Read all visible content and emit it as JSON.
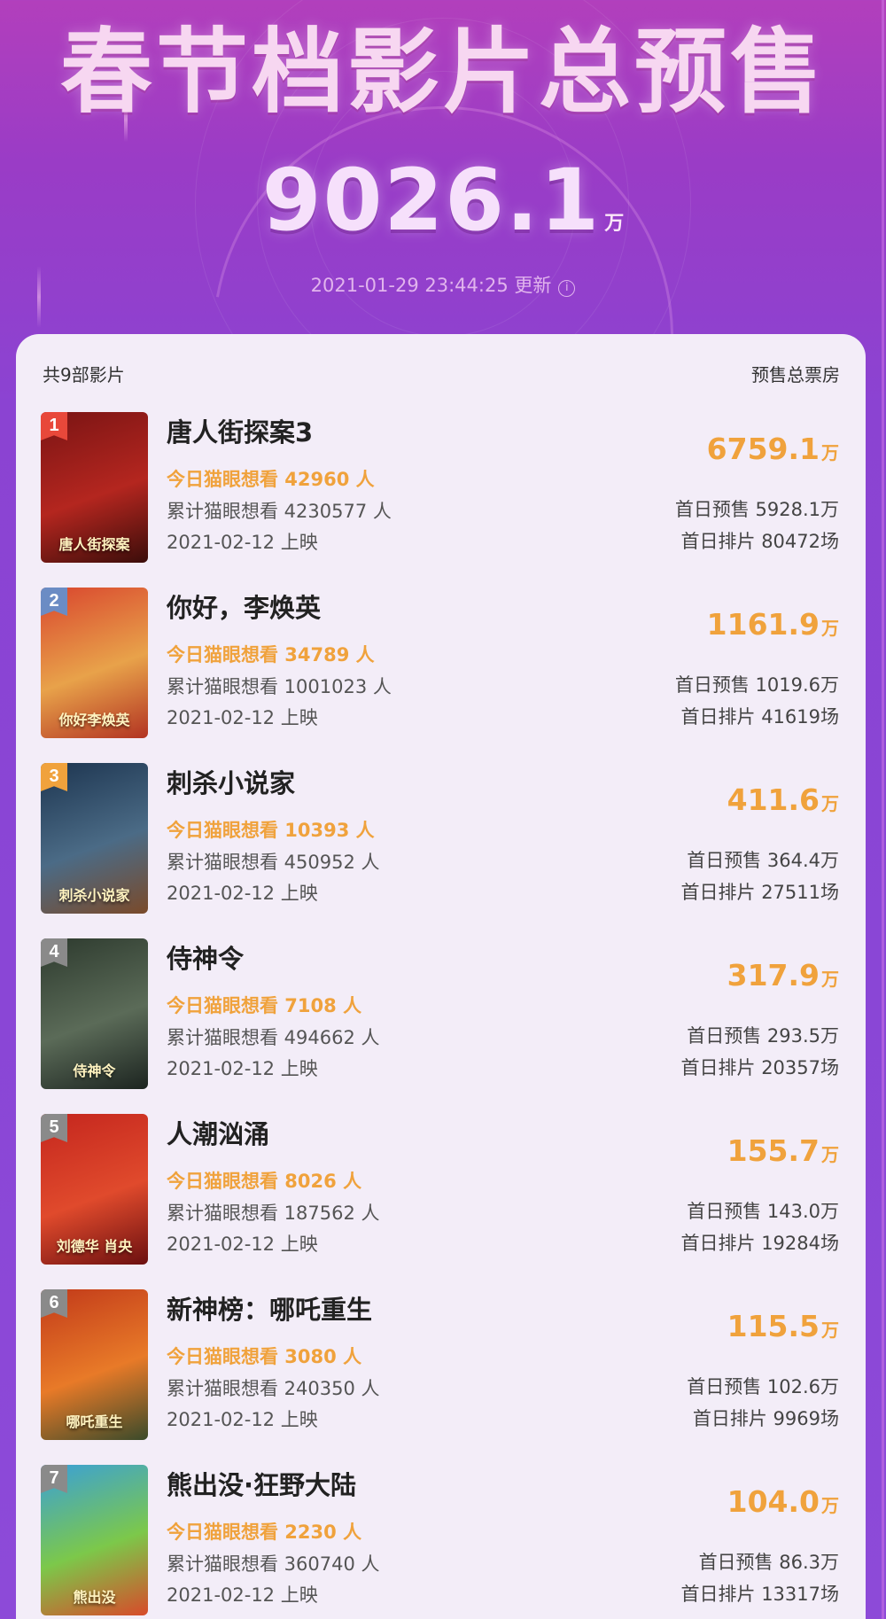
{
  "header": {
    "title": "春节档影片总预售",
    "total_value": "9026.1",
    "total_unit": "万",
    "update_text": "2021-01-29 23:44:25 更新"
  },
  "list": {
    "count_label": "共9部影片",
    "column_label": "预售总票房",
    "films": [
      {
        "rank": "1",
        "title": "唐人街探案3",
        "today": "今日猫眼想看 42960 人",
        "cumulative": "累计猫眼想看 4230577 人",
        "release": "2021-02-12 上映",
        "total": "6759.1",
        "unit": "万",
        "first_day_presale": "首日预售 5928.1万",
        "first_day_shows": "首日排片 80472场",
        "poster_text": "唐人街探案",
        "badge_color": "#e8483a",
        "poster_colors": [
          "#7a1414",
          "#b4261f",
          "#3b0d0a"
        ]
      },
      {
        "rank": "2",
        "title": "你好，李焕英",
        "today": "今日猫眼想看 34789 人",
        "cumulative": "累计猫眼想看 1001023 人",
        "release": "2021-02-12 上映",
        "total": "1161.9",
        "unit": "万",
        "first_day_presale": "首日预售 1019.6万",
        "first_day_shows": "首日排片 41619场",
        "poster_text": "你好李焕英",
        "badge_color": "#6b8cc4",
        "poster_colors": [
          "#d9462e",
          "#e8a24a",
          "#b23322"
        ]
      },
      {
        "rank": "3",
        "title": "刺杀小说家",
        "today": "今日猫眼想看 10393 人",
        "cumulative": "累计猫眼想看 450952 人",
        "release": "2021-02-12 上映",
        "total": "411.6",
        "unit": "万",
        "first_day_presale": "首日预售 364.4万",
        "first_day_shows": "首日排片 27511场",
        "poster_text": "刺杀小说家",
        "badge_color": "#f0a23c",
        "poster_colors": [
          "#1d3550",
          "#4b6b86",
          "#7a4a2a"
        ]
      },
      {
        "rank": "4",
        "title": "侍神令",
        "today": "今日猫眼想看 7108 人",
        "cumulative": "累计猫眼想看 494662 人",
        "release": "2021-02-12 上映",
        "total": "317.9",
        "unit": "万",
        "first_day_presale": "首日预售 293.5万",
        "first_day_shows": "首日排片 20357场",
        "poster_text": "侍神令",
        "badge_color": "#8a8a8a",
        "poster_colors": [
          "#2d3a2e",
          "#5b6b58",
          "#1c2420"
        ]
      },
      {
        "rank": "5",
        "title": "人潮汹涌",
        "today": "今日猫眼想看 8026 人",
        "cumulative": "累计猫眼想看 187562 人",
        "release": "2021-02-12 上映",
        "total": "155.7",
        "unit": "万",
        "first_day_presale": "首日预售 143.0万",
        "first_day_shows": "首日排片 19284场",
        "poster_text": "刘德华 肖央",
        "badge_color": "#8a8a8a",
        "poster_colors": [
          "#c4261e",
          "#e04a2c",
          "#6b1010"
        ]
      },
      {
        "rank": "6",
        "title": "新神榜：哪吒重生",
        "today": "今日猫眼想看 3080 人",
        "cumulative": "累计猫眼想看 240350 人",
        "release": "2021-02-12 上映",
        "total": "115.5",
        "unit": "万",
        "first_day_presale": "首日预售 102.6万",
        "first_day_shows": "首日排片 9969场",
        "poster_text": "哪吒重生",
        "badge_color": "#8a8a8a",
        "poster_colors": [
          "#c23a1a",
          "#e87a28",
          "#3a4a2a"
        ]
      },
      {
        "rank": "7",
        "title": "熊出没·狂野大陆",
        "today": "今日猫眼想看 2230 人",
        "cumulative": "累计猫眼想看 360740 人",
        "release": "2021-02-12 上映",
        "total": "104.0",
        "unit": "万",
        "first_day_presale": "首日预售 86.3万",
        "first_day_shows": "首日排片 13317场",
        "poster_text": "熊出没",
        "badge_color": "#8a8a8a",
        "poster_colors": [
          "#3aa0d8",
          "#7cc84a",
          "#d84a2a"
        ]
      }
    ]
  }
}
